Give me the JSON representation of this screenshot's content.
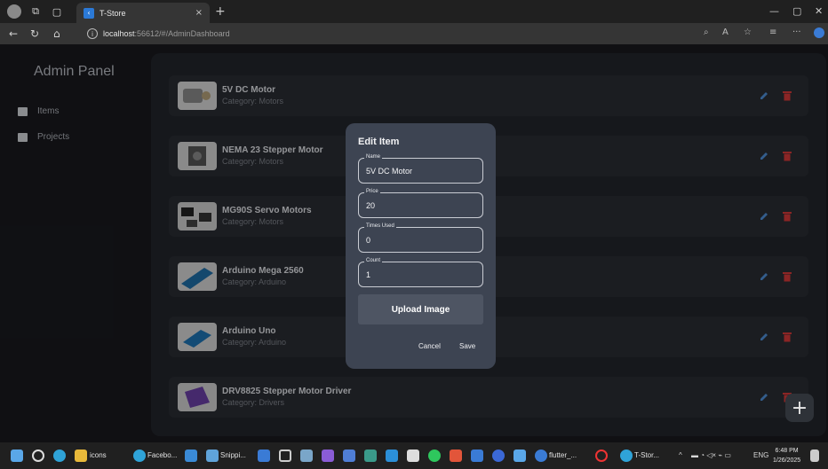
{
  "browser": {
    "tab_title": "T-Store",
    "tab_close": "×",
    "new_tab": "+",
    "url_host": "localhost",
    "url_rest": ":56612/#/AdminDashboard",
    "win_min": "—",
    "win_max": "▢",
    "win_close": "✕"
  },
  "sidebar": {
    "title": "Admin Panel",
    "items": [
      {
        "label": "Items",
        "icon": "box-icon"
      },
      {
        "label": "Projects",
        "icon": "briefcase-icon"
      }
    ]
  },
  "items": [
    {
      "name": "5V DC Motor",
      "category": "Category: Motors"
    },
    {
      "name": "NEMA 23 Stepper Motor",
      "category": "Category: Motors"
    },
    {
      "name": "MG90S Servo Motors",
      "category": "Category: Motors"
    },
    {
      "name": "Arduino Mega 2560",
      "category": "Category: Arduino"
    },
    {
      "name": "Arduino Uno",
      "category": "Category: Arduino"
    },
    {
      "name": "DRV8825 Stepper Motor Driver",
      "category": "Category: Drivers"
    }
  ],
  "dialog": {
    "title": "Edit Item",
    "fields": [
      {
        "label": "Name",
        "value": "5V DC Motor"
      },
      {
        "label": "Price",
        "value": "20"
      },
      {
        "label": "Times Used",
        "value": "0"
      },
      {
        "label": "Count",
        "value": "1"
      }
    ],
    "upload_label": "Upload Image",
    "cancel_label": "Cancel",
    "save_label": "Save"
  },
  "fab_label": "+",
  "taskbar": {
    "apps": [
      {
        "label": "icons"
      },
      {
        "label": "Facebo..."
      },
      {
        "label": "Snippi..."
      },
      {
        "label": "flutter_..."
      },
      {
        "label": "T-Stor..."
      }
    ],
    "lang": "ENG",
    "time": "6:48 PM",
    "date": "1/26/2025"
  },
  "colors": {
    "accent_edit": "#4f8fd8",
    "accent_delete": "#d63a3a",
    "dialog_bg": "#3d4452"
  }
}
